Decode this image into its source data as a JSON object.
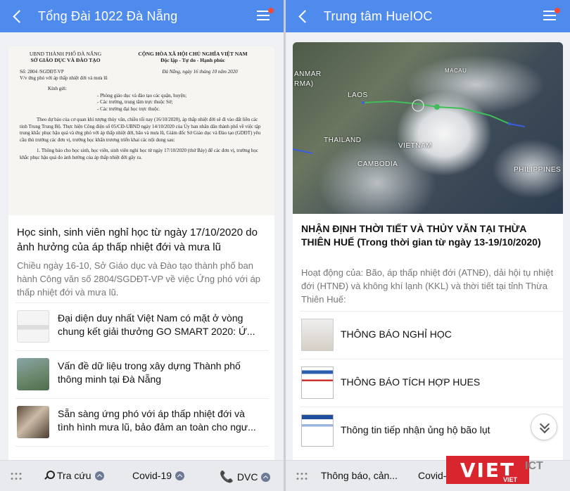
{
  "left": {
    "header": {
      "title": "Tổng Đài 1022 Đà Nẵng"
    },
    "document": {
      "org_line1": "UBND THÀNH PHỐ ĐÀ NẴNG",
      "org_line2": "SỞ GIÁO DỤC VÀ ĐÀO TẠO",
      "nation_line1": "CỘNG HÒA XÃ HỘI CHỦ NGHĨA VIỆT NAM",
      "nation_line2": "Độc lập - Tự do - Hạnh phúc",
      "number": "Số: 2804 /SGDĐT-VP",
      "subject": "V/v ứng phó với áp thấp nhiệt đới và mưa lũ",
      "date": "Đà Nẵng, ngày 16 tháng 10 năm 2020",
      "kinh_gui": "Kính gửi:",
      "recipient1": "- Phòng giáo dục và đào tạo các quận, huyện;",
      "recipient2": "- Các trường, trung tâm trực thuộc Sở;",
      "recipient3": "- Các trường đại học trực thuộc.",
      "body1": "Theo dự báo của cơ quan khí tượng thủy văn, chiều tối nay (16/10/2020), áp thấp nhiệt đới sẽ đi vào đất liền các tỉnh Trung Trung Bộ. Thực hiện Công điện số 05/CĐ-UBND ngày 14/10/2020 của Ủy ban nhân dân thành phố về việc tập trung khắc phục hậu quả và ứng phó với áp thấp nhiệt đới, bão và mưa lũ, Giám đốc Sở Giáo dục và Đào tạo (GDĐT) yêu cầu thủ trưởng các đơn vị, trường học khẩn trương triển khai các nội dung sau:",
      "body2": "1. Thông báo cho học sinh, học viên, sinh viên nghỉ học từ ngày 17/10/2020 (thứ Bảy) để các đơn vị, trường học khắc phục hậu quả do ảnh hưởng của áp thấp nhiệt đới gây ra."
    },
    "headline": "Học sinh, sinh viên nghỉ học từ ngày 17/10/2020 do ảnh hưởng của áp thấp nhiệt đới và mưa lũ",
    "summary": "Chiều ngày 16-10, Sở Giáo dục và Đào tạo thành phố ban hành Công văn số 2804/SGDĐT-VP về việc Ứng phó với áp thấp nhiệt đới và mưa lũ.",
    "news": [
      {
        "line1": "Đại diện duy nhất Việt Nam có mặt ở vòng",
        "line2": "chung kết giải thưởng GO SMART 2020: Ứ..."
      },
      {
        "line1": "Vấn đề dữ liệu trong xây dựng Thành phố",
        "line2": "thông minh tại Đà Nẵng"
      },
      {
        "line1": "Sẵn sàng ứng phó với áp thấp nhiệt đới và",
        "line2": "tình hình mưa lũ, bảo đảm an toàn cho ngư..."
      }
    ],
    "bottom": {
      "item1": "Tra cứu",
      "item2": "Covid-19",
      "item3": "DVC"
    }
  },
  "right": {
    "header": {
      "title": "Trung tâm HueIOC"
    },
    "map_labels": {
      "laos": "LAOS",
      "thailand": "THAILAND",
      "vietnam": "VIETNAM",
      "cambodia": "CAMBODIA",
      "philippines": "PHILIPPINES",
      "myanmar": "ANMAR",
      "burma": "RMA)",
      "macau": "MACAU"
    },
    "title": "NHẬN ĐỊNH THỜI TIẾT VÀ THỦY VĂN TẠI THỪA THIÊN HUẾ (Trong thời gian từ ngày 13-19/10/2020)",
    "summary": "Hoạt động của: Bão, áp thấp nhiệt đới (ATNĐ), dải hội tụ nhiệt đới (HTNĐ) và không khí lạnh (KKL) và thời tiết tại tỉnh Thừa Thiên Huế:",
    "items": [
      "THÔNG BÁO NGHỈ HỌC",
      "THÔNG BÁO TÍCH HỢP HUES",
      "Thông tin tiếp nhận ủng hộ bão lụt"
    ],
    "bottom": {
      "item1": "Thông báo, cản...",
      "item2": "Covid-19"
    },
    "logo": {
      "brand": "VIET",
      "tag": "ICT",
      "small": "VIET"
    }
  },
  "colors": {
    "header_blue": "#4f8bec",
    "logo_red": "#d9262e"
  }
}
